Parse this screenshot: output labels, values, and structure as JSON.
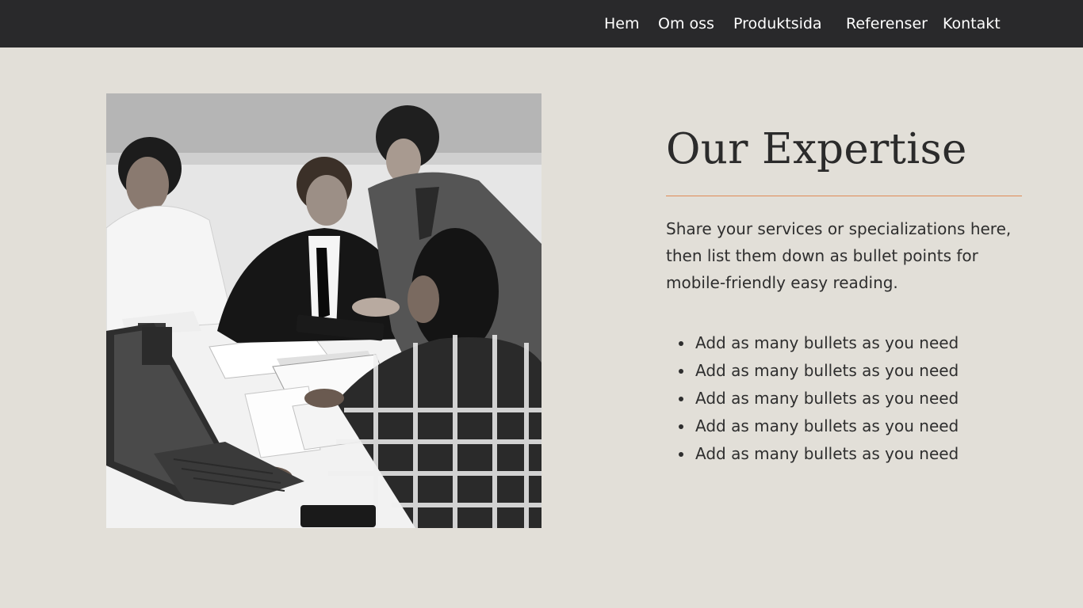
{
  "nav": {
    "items": [
      {
        "label": "Hem"
      },
      {
        "label": "Om oss"
      },
      {
        "label": "Produktsida"
      },
      {
        "label": "Referenser"
      },
      {
        "label": "Kontakt"
      }
    ]
  },
  "hero_image": {
    "icon": "team-meeting-photo"
  },
  "section": {
    "title": "Our Expertise",
    "intro": "Share your services or specializations here, then list them down as bullet points for mobile-friendly easy reading.",
    "bullets": [
      "Add as many bullets as you need",
      "Add as many bullets as you need",
      "Add as many bullets as you need",
      "Add as many bullets as you need",
      "Add as many bullets as you need"
    ]
  },
  "colors": {
    "background": "#e2dfd8",
    "navbar": "#29292b",
    "accent_divider": "#e08a55",
    "text": "#2b2b2b"
  }
}
